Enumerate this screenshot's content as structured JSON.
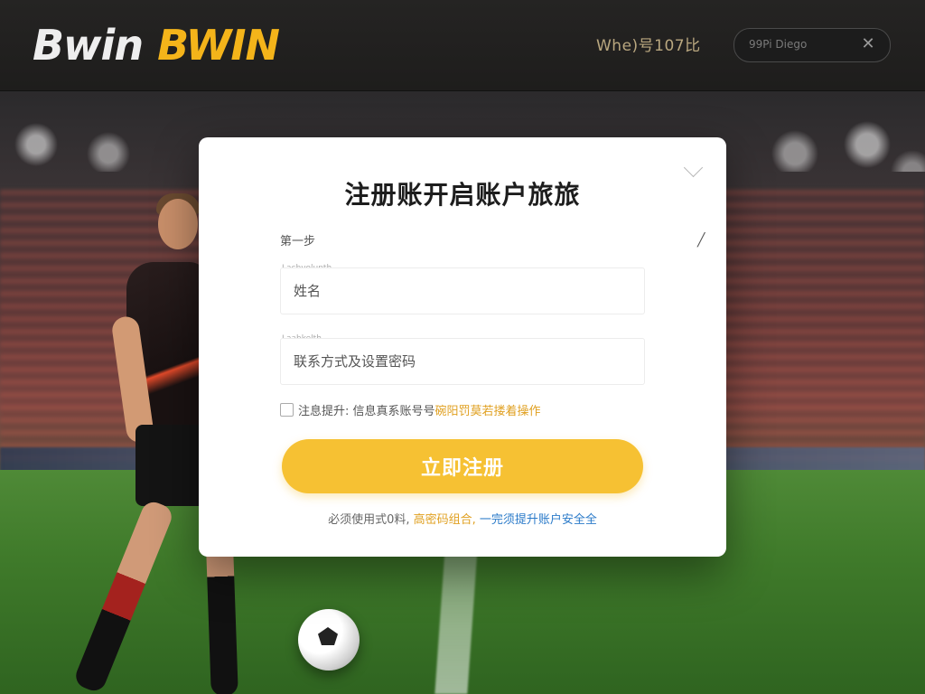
{
  "header": {
    "logo_white": "Bwin",
    "logo_yellow": "BWIN",
    "link": "Whe)号107比",
    "search_placeholder": "99Pi Diego",
    "close_icon": "close-icon"
  },
  "modal": {
    "title": "注册账开启账户旅旅",
    "step": "第一步",
    "field1_tag": "Lacbvolunth",
    "field1_placeholder": "姓名",
    "field2_tag": "Laabkelth",
    "field2_placeholder": "联系方式及设置密码",
    "agree_prefix": "注息提升: 信息真系账号号",
    "agree_link": "碗阳罚莫若搂着操作",
    "register_button": "立即注册",
    "tip_prefix": "必须使用式0料,",
    "tip_highlight": "高密码组合,",
    "tip_blue": "一完须提升账户安全全"
  },
  "colors": {
    "accent": "#f6c133",
    "logo_yellow": "#f4b41a",
    "link_blue": "#2a7ac9"
  }
}
